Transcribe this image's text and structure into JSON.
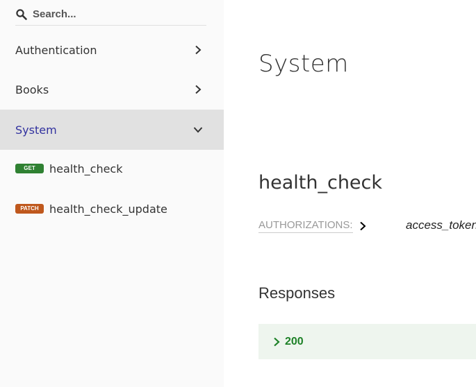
{
  "search": {
    "placeholder": "Search..."
  },
  "sidebar": {
    "items": [
      {
        "label": "Authentication"
      },
      {
        "label": "Books"
      },
      {
        "label": "System"
      }
    ],
    "operations": [
      {
        "method": "GET",
        "label": "health_check",
        "color": "#2f8132"
      },
      {
        "method": "PATCH",
        "label": "health_check_update",
        "color": "#bf581d"
      }
    ],
    "active_color": "#32329f"
  },
  "main": {
    "section_title": "System",
    "operation_title": "health_check",
    "authorizations_label": "AUTHORIZATIONS:",
    "authorizations_value": "access_token",
    "responses_title": "Responses",
    "responses": [
      {
        "code": "200",
        "color": "#1d8127"
      }
    ]
  },
  "icons": {
    "search": "search-icon",
    "chevron_right": "chevron-right-icon",
    "chevron_down": "chevron-down-icon"
  }
}
